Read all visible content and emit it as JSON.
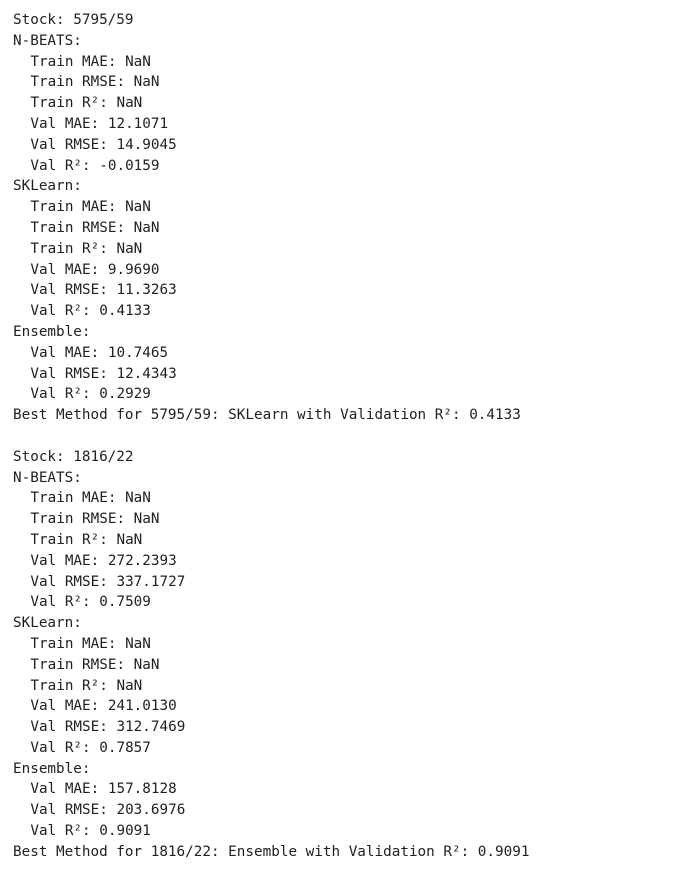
{
  "output": {
    "blocks": [
      {
        "stock_line": "Stock: 5795/59",
        "models": [
          {
            "name": "N-BEATS:",
            "metrics": [
              "Train MAE: NaN",
              "Train RMSE: NaN",
              "Train R²: NaN",
              "Val MAE: 12.1071",
              "Val RMSE: 14.9045",
              "Val R²: -0.0159"
            ]
          },
          {
            "name": "SKLearn:",
            "metrics": [
              "Train MAE: NaN",
              "Train RMSE: NaN",
              "Train R²: NaN",
              "Val MAE: 9.9690",
              "Val RMSE: 11.3263",
              "Val R²: 0.4133"
            ]
          },
          {
            "name": "Ensemble:",
            "metrics": [
              "Val MAE: 10.7465",
              "Val RMSE: 12.4343",
              "Val R²: 0.2929"
            ]
          }
        ],
        "best_line": "Best Method for 5795/59: SKLearn with Validation R²: 0.4133"
      },
      {
        "stock_line": "Stock: 1816/22",
        "models": [
          {
            "name": "N-BEATS:",
            "metrics": [
              "Train MAE: NaN",
              "Train RMSE: NaN",
              "Train R²: NaN",
              "Val MAE: 272.2393",
              "Val RMSE: 337.1727",
              "Val R²: 0.7509"
            ]
          },
          {
            "name": "SKLearn:",
            "metrics": [
              "Train MAE: NaN",
              "Train RMSE: NaN",
              "Train R²: NaN",
              "Val MAE: 241.0130",
              "Val RMSE: 312.7469",
              "Val R²: 0.7857"
            ]
          },
          {
            "name": "Ensemble:",
            "metrics": [
              "Val MAE: 157.8128",
              "Val RMSE: 203.6976",
              "Val R²: 0.9091"
            ]
          }
        ],
        "best_line": "Best Method for 1816/22: Ensemble with Validation R²: 0.9091"
      }
    ]
  }
}
